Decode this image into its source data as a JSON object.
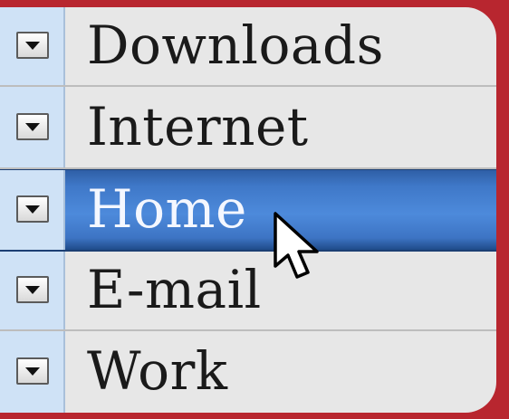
{
  "menu": {
    "items": [
      {
        "label": "Downloads",
        "selected": false
      },
      {
        "label": "Internet",
        "selected": false
      },
      {
        "label": "Home",
        "selected": true
      },
      {
        "label": "E-mail",
        "selected": false
      },
      {
        "label": "Work",
        "selected": false
      }
    ]
  },
  "colors": {
    "background": "#b8262f",
    "panel": "#e7e7e7",
    "gutter": "#cfe2f6",
    "selection": "#3f78c8",
    "selection_text": "#f4f7ff",
    "text": "#1a1a1a"
  },
  "icons": {
    "dropdown": "chevron-down-icon",
    "pointer": "mouse-pointer-icon"
  }
}
